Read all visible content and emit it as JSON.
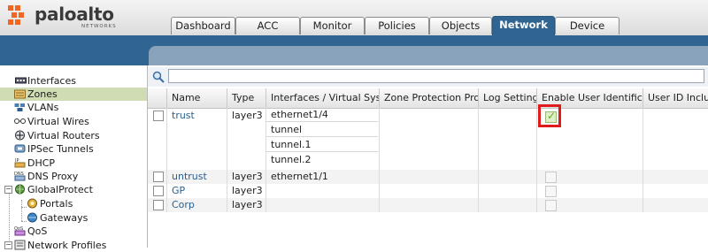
{
  "brand": {
    "name": "paloalto",
    "tagline": "NETWORKS"
  },
  "tabs": [
    {
      "label": "Dashboard"
    },
    {
      "label": "ACC"
    },
    {
      "label": "Monitor"
    },
    {
      "label": "Policies"
    },
    {
      "label": "Objects"
    },
    {
      "label": "Network",
      "active": true
    },
    {
      "label": "Device"
    }
  ],
  "sidebar": {
    "items": [
      {
        "label": "Interfaces",
        "icon": "interfaces-icon"
      },
      {
        "label": "Zones",
        "icon": "zones-icon",
        "selected": true
      },
      {
        "label": "VLANs",
        "icon": "vlans-icon"
      },
      {
        "label": "Virtual Wires",
        "icon": "virtual-wires-icon"
      },
      {
        "label": "Virtual Routers",
        "icon": "virtual-routers-icon"
      },
      {
        "label": "IPSec Tunnels",
        "icon": "ipsec-tunnels-icon"
      },
      {
        "label": "DHCP",
        "icon": "dhcp-icon"
      },
      {
        "label": "DNS Proxy",
        "icon": "dns-proxy-icon"
      },
      {
        "label": "GlobalProtect",
        "icon": "globalprotect-icon",
        "expanded": true
      },
      {
        "label": "Portals",
        "icon": "portals-icon"
      },
      {
        "label": "Gateways",
        "icon": "gateways-icon"
      },
      {
        "label": "QoS",
        "icon": "qos-icon"
      },
      {
        "label": "Network Profiles",
        "icon": "network-profiles-icon",
        "expanded": true
      }
    ]
  },
  "search": {
    "value": "",
    "placeholder": ""
  },
  "table": {
    "columns": [
      "",
      "Name",
      "Type",
      "Interfaces / Virtual Systems",
      "Zone Protection Profile",
      "Log Setting",
      "Enable User Identification",
      "User ID Include L"
    ],
    "rows": [
      {
        "name": "trust",
        "type": "layer3",
        "interfaces": [
          "ethernet1/4",
          "tunnel",
          "tunnel.1",
          "tunnel.2"
        ],
        "zone_protection": "",
        "log_setting": "",
        "user_id": true
      },
      {
        "name": "untrust",
        "type": "layer3",
        "interfaces": [
          "ethernet1/1"
        ],
        "zone_protection": "",
        "log_setting": "",
        "user_id": false
      },
      {
        "name": "GP",
        "type": "layer3",
        "interfaces": [],
        "zone_protection": "",
        "log_setting": "",
        "user_id": false
      },
      {
        "name": "Corp",
        "type": "layer3",
        "interfaces": [],
        "zone_protection": "",
        "log_setting": "",
        "user_id": false
      }
    ]
  },
  "colors": {
    "header_blue": "#2f6590",
    "selected_row": "#cfdcb4",
    "link": "#2a5f8f",
    "highlight_red": "#e01b1b",
    "logo_orange": "#f26522"
  }
}
